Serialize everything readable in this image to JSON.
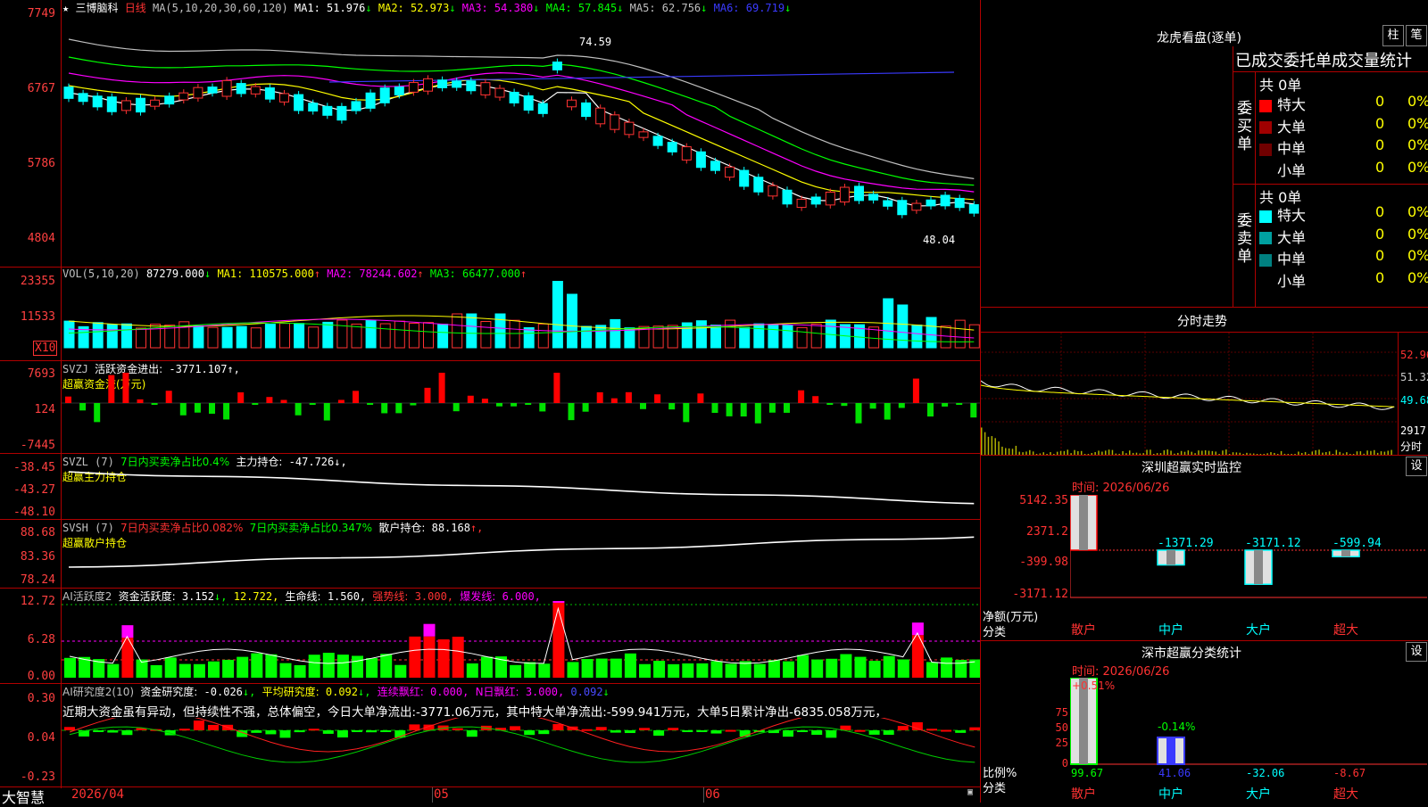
{
  "stock": {
    "name": "三博脑科",
    "period": "日线",
    "star": "★"
  },
  "main_panel": {
    "ma_label": "MA(5,10,20,30,60,120)",
    "ma": [
      {
        "label": "MA1:",
        "value": "51.976",
        "arrow": "↓",
        "color": "#ffffff"
      },
      {
        "label": "MA2:",
        "value": "52.973",
        "arrow": "↓",
        "color": "#ffff00"
      },
      {
        "label": "MA3:",
        "value": "54.380",
        "arrow": "↓",
        "color": "#ff00ff"
      },
      {
        "label": "MA4:",
        "value": "57.845",
        "arrow": "↓",
        "color": "#00ff00"
      },
      {
        "label": "MA5:",
        "value": "62.756",
        "arrow": "↓",
        "color": "#c0c0c0"
      },
      {
        "label": "MA6:",
        "value": "69.719",
        "arrow": "↓",
        "color": "#3a3aff"
      }
    ],
    "y_ticks": [
      "7749",
      "6767",
      "5786",
      "4804"
    ],
    "high_marker": "74.59",
    "low_marker": "48.04"
  },
  "vol_panel": {
    "title": "VOL(5,10,20)",
    "value": "87279.000",
    "arrow": "↓",
    "ma": [
      {
        "label": "MA1:",
        "value": "110575.000",
        "arrow": "↑",
        "color": "#ffff00"
      },
      {
        "label": "MA2:",
        "value": "78244.602",
        "arrow": "↑",
        "color": "#ff00ff"
      },
      {
        "label": "MA3:",
        "value": "66477.000",
        "arrow": "↑",
        "color": "#00ff00"
      }
    ],
    "y_ticks": [
      "23355",
      "11533"
    ],
    "unit": "X10"
  },
  "svzj_panel": {
    "title": "SVZJ",
    "label": "活跃资金进出:",
    "value": "-3771.107",
    "arrow": "↑,",
    "subtitle": "超赢资金流(万元)",
    "y_ticks": [
      "7693",
      "124",
      "-7445"
    ]
  },
  "svzl_panel": {
    "title": "SVZL (7)",
    "ratio_text": "7日内买卖净占比0.4%",
    "hold_label": "主力持仓:",
    "hold_value": "-47.726",
    "arrow": "↓,",
    "subtitle": "超赢主力持仓",
    "y_ticks": [
      "-38.45",
      "-43.27",
      "-48.10"
    ]
  },
  "svsh_panel": {
    "title": "SVSH (7)",
    "ratio1": "7日内买卖净占比0.082%",
    "ratio2": "7日内买卖净占比0.347%",
    "hold_label": "散户持仓:",
    "hold_value": "88.168",
    "arrow": "↑,",
    "subtitle": "超赢散户持仓",
    "y_ticks": [
      "88.68",
      "83.36",
      "78.24"
    ]
  },
  "ai_active_panel": {
    "title": "AI活跃度2",
    "act_label": "资金活跃度:",
    "act_value": "3.152",
    "arrow": "↓,",
    "v2": "12.722,",
    "life_label": "生命线:",
    "life_value": "1.560,",
    "strong_label": "强势线:",
    "strong_value": "3.000,",
    "burst_label": "爆发线:",
    "burst_value": "6.000,",
    "y_ticks": [
      "12.72",
      "6.28",
      "0.00"
    ]
  },
  "ai_research_panel": {
    "title": "AI研究度2(10)",
    "res_label": "资金研究度:",
    "res_value": "-0.026",
    "arrow": "↓,",
    "avg_label": "平均研究度:",
    "avg_value": "0.092",
    "cont_label": "连续飘红:",
    "cont_value": "0.000,",
    "n_label": "N日飘红:",
    "n_value": "3.000,",
    "last_value": "0.092",
    "comment": "近期大资金虽有异动，但持续性不强，总体偏空，今日大单净流出:-3771.06万元，其中特大单净流出:-599.941万元，大单5日累计净出-6835.058万元，",
    "y_ticks": [
      "0.30",
      "0.04",
      "-0.23"
    ]
  },
  "x_axis": {
    "labels": [
      "2026/04",
      "05",
      "06"
    ]
  },
  "bottom_logo": "大智慧",
  "dragon_tiger": {
    "title": "龙虎看盘(逐单)",
    "btn1": "柱",
    "btn2": "笔",
    "header": "已成交委托单成交量统计",
    "buy_group": "委买单",
    "sell_group": "委卖单",
    "buy_total": "共 0单",
    "sell_total": "共 0单",
    "buy_rows": [
      {
        "label": "特大",
        "color": "#ff0000",
        "count": "0",
        "pct": "0%"
      },
      {
        "label": "大单",
        "color": "#a00000",
        "count": "0",
        "pct": "0%"
      },
      {
        "label": "中单",
        "color": "#700000",
        "count": "0",
        "pct": "0%"
      },
      {
        "label": "小单",
        "color": "#000000",
        "count": "0",
        "pct": "0%"
      }
    ],
    "sell_rows": [
      {
        "label": "特大",
        "color": "#00ffff",
        "count": "0",
        "pct": "0%"
      },
      {
        "label": "大单",
        "color": "#00a0a0",
        "count": "0",
        "pct": "0%"
      },
      {
        "label": "中单",
        "color": "#008080",
        "count": "0",
        "pct": "0%"
      },
      {
        "label": "小单",
        "color": "#000000",
        "count": "0",
        "pct": "0%"
      }
    ]
  },
  "intraday": {
    "title": "分时走势",
    "prices": [
      "52.96",
      "51.32",
      "49.68"
    ],
    "vol_label": "2917",
    "vol_unit": "分时"
  },
  "sz_monitor": {
    "title": "深圳超赢实时监控",
    "btn": "设",
    "time": "时间: 2026/06/26",
    "y_ticks": [
      "5142.35",
      "2371.2",
      "-399.98",
      "-3171.12"
    ],
    "y_label": "净额(万元)",
    "x_label": "分类",
    "bars": [
      {
        "cat": "散户",
        "value": "5142.35"
      },
      {
        "cat": "中户",
        "value": "-1371.29"
      },
      {
        "cat": "大户",
        "value": "-3171.12"
      },
      {
        "cat": "超大",
        "value": "-599.94"
      }
    ]
  },
  "sz_class": {
    "title": "深市超赢分类统计",
    "btn": "设",
    "time": "时间: 2026/06/26",
    "y_ticks": [
      "75",
      "50",
      "25",
      "0"
    ],
    "y_label": "比例%",
    "x_label": "分类",
    "bar_labels": [
      "+0.51%",
      "-0.14%"
    ],
    "bars": [
      {
        "cat": "散户",
        "value": "99.67",
        "color": "#00ff00"
      },
      {
        "cat": "中户",
        "value": "41.06",
        "color": "#3a3aff"
      },
      {
        "cat": "大户",
        "value": "-32.06",
        "color": "#00ffff"
      },
      {
        "cat": "超大",
        "value": "-8.67",
        "color": "#ff3232"
      }
    ]
  }
}
